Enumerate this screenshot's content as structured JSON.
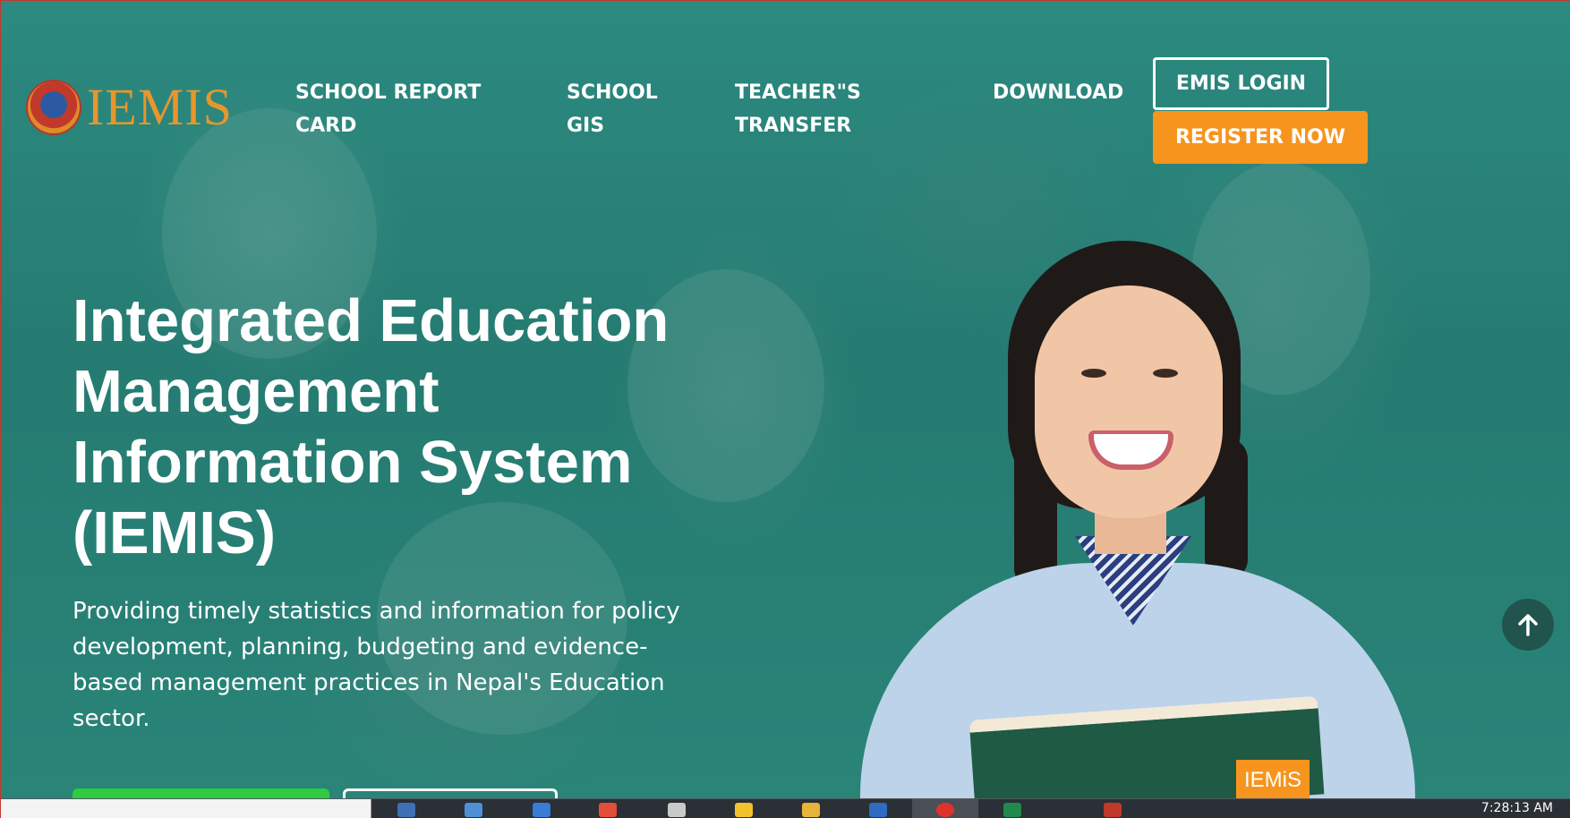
{
  "header": {
    "logo_text": "IEMIS",
    "nav": [
      {
        "label": "SCHOOL REPORT CARD"
      },
      {
        "label": "SCHOOL GIS"
      },
      {
        "label": "TEACHER\"S TRANSFER"
      },
      {
        "label": "DOWNLOAD"
      }
    ],
    "login_label": "EMIS LOGIN",
    "register_label": "REGISTER NOW"
  },
  "hero": {
    "title": "Integrated Education Management Information System (IEMIS)",
    "description": "Providing timely statistics and information for policy development, planning, budgeting and evidence-based management practices in Nepal's Education sector."
  },
  "notebook_label": "IEMiS",
  "taskbar": {
    "clock": "7:28:13 AM"
  },
  "colors": {
    "brand_orange": "#f7941d",
    "hero_teal": "#2a7d74",
    "cta_green": "#2ecc40"
  },
  "icons": [
    "arrow-up-icon",
    "logo-emblem-icon"
  ]
}
